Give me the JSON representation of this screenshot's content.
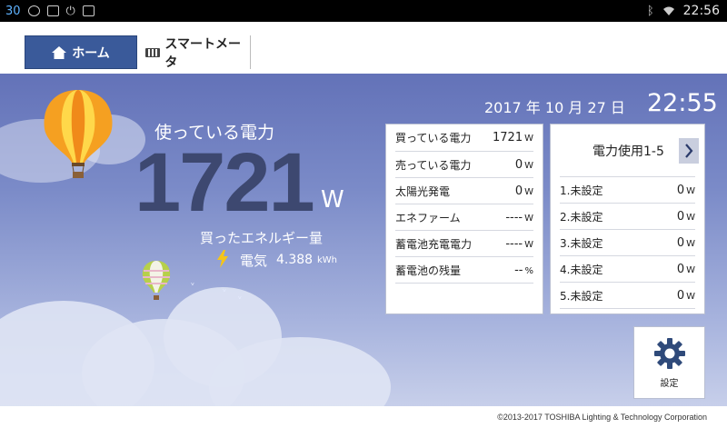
{
  "status_bar": {
    "left_number": "30",
    "time": "22:56",
    "icons": [
      "eye-icon",
      "sd-card-icon",
      "power-icon",
      "notification-icon",
      "bluetooth-icon",
      "wifi-icon"
    ]
  },
  "nav": {
    "home_label": "ホーム",
    "meter_label": "スマートメータ"
  },
  "main": {
    "power_label": "使っている電力",
    "power_value": "1721",
    "power_unit": "W",
    "energy_label": "買ったエネルギー量",
    "electricity_label": "電気",
    "electricity_value": "4.388",
    "electricity_unit": "kWh",
    "date": "2017 年 10 月 27 日",
    "clock": "22:55"
  },
  "status_panel": {
    "rows": [
      {
        "label": "買っている電力",
        "value": "1721",
        "unit": "W"
      },
      {
        "label": "売っている電力",
        "value": "0",
        "unit": "W"
      },
      {
        "label": "太陽光発電",
        "value": "0",
        "unit": "W"
      },
      {
        "label": "エネファーム",
        "value": "----",
        "unit": "W"
      },
      {
        "label": "蓄電池充電電力",
        "value": "----",
        "unit": "W"
      },
      {
        "label": "蓄電池の残量",
        "value": "--",
        "unit": "%"
      }
    ]
  },
  "usage_panel": {
    "title": "電力使用1-5",
    "items": [
      {
        "label": "1.未設定",
        "value": "0",
        "unit": "W"
      },
      {
        "label": "2.未設定",
        "value": "0",
        "unit": "W"
      },
      {
        "label": "3.未設定",
        "value": "0",
        "unit": "W"
      },
      {
        "label": "4.未設定",
        "value": "0",
        "unit": "W"
      },
      {
        "label": "5.未設定",
        "value": "0",
        "unit": "W"
      }
    ]
  },
  "settings": {
    "label": "設定"
  },
  "footer": {
    "copyright": "©2013-2017 TOSHIBA Lighting & Technology Corporation"
  },
  "colors": {
    "accent": "#3a5a9a",
    "gauge_text": "#3d4870",
    "bolt": "#f5c518"
  }
}
